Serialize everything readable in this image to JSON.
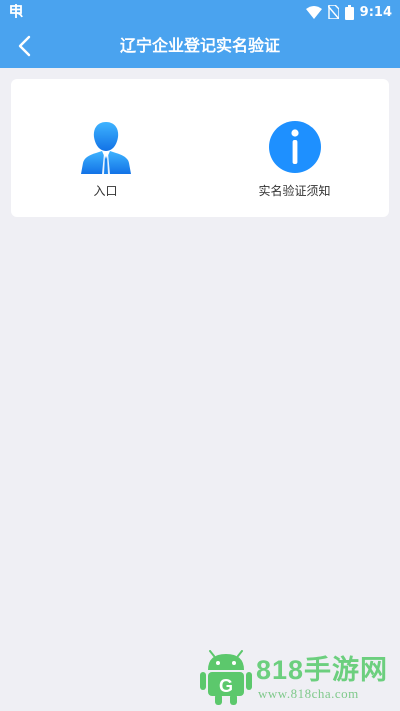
{
  "status_bar": {
    "time": "9:14",
    "left_icon": "app-notification-icon",
    "right_icons": [
      "wifi-icon",
      "no-sim-icon",
      "battery-icon"
    ]
  },
  "header": {
    "title": "辽宁企业登记实名验证",
    "back_icon": "back-arrow-icon"
  },
  "menu": [
    {
      "label": "入口",
      "icon": "user-silhouette-icon"
    },
    {
      "label": "实名验证须知",
      "icon": "info-icon"
    }
  ],
  "watermark": {
    "text": "818手游网",
    "url": "www.818cha.com",
    "logo_letter": "G"
  },
  "colors": {
    "primary": "#4aa3ef",
    "background": "#efeff4",
    "card": "#ffffff",
    "icon_blue": "#1e90ff",
    "watermark_green": "#6ccf7e"
  }
}
